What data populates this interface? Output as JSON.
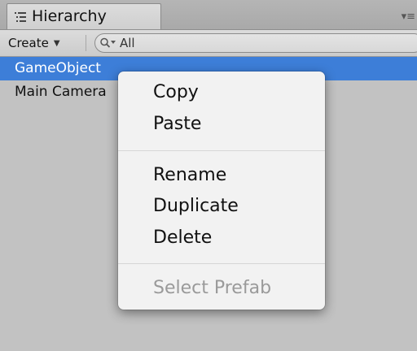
{
  "tab": {
    "title": "Hierarchy",
    "icon": "list-icon",
    "menu_icon": "panel-menu-icon"
  },
  "toolbar": {
    "create_label": "Create",
    "search": {
      "placeholder": "All",
      "value": ""
    }
  },
  "hierarchy": {
    "items": [
      {
        "label": "GameObject",
        "selected": true
      },
      {
        "label": "Main Camera",
        "selected": false
      }
    ]
  },
  "context_menu": {
    "items": [
      {
        "label": "Copy",
        "enabled": true
      },
      {
        "label": "Paste",
        "enabled": true
      },
      {
        "label": "Rename",
        "enabled": true
      },
      {
        "label": "Duplicate",
        "enabled": true
      },
      {
        "label": "Delete",
        "enabled": true
      },
      {
        "label": "Select Prefab",
        "enabled": false
      }
    ]
  },
  "colors": {
    "selection": "#3d7ed8",
    "panel_background": "#c2c2c2",
    "menu_background": "#f2f2f2",
    "disabled_text": "#9a9a9a"
  }
}
